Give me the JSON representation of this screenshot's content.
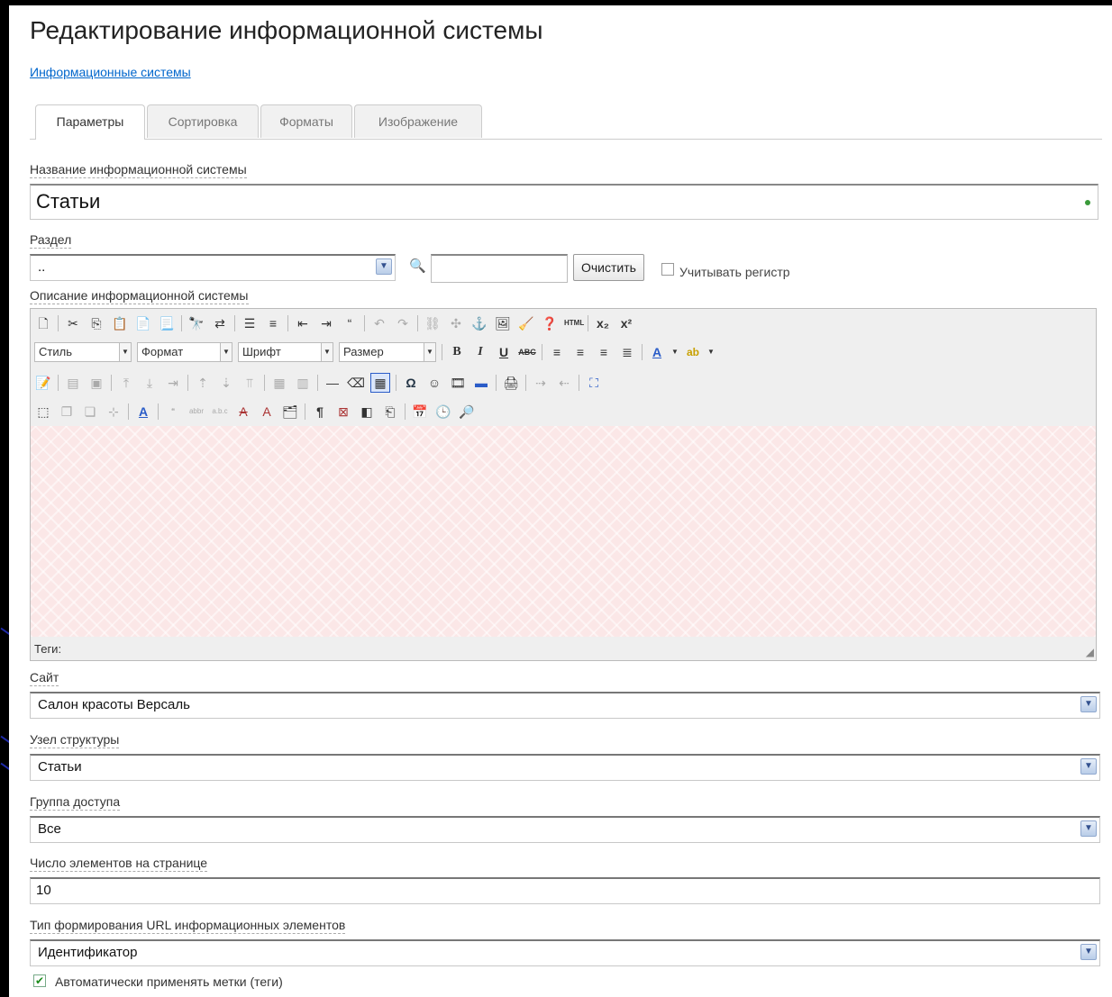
{
  "page": {
    "title": "Редактирование информационной системы",
    "breadcrumb": "Информационные системы"
  },
  "tabs": [
    {
      "label": "Параметры"
    },
    {
      "label": "Сортировка"
    },
    {
      "label": "Форматы"
    },
    {
      "label": "Изображение"
    }
  ],
  "form": {
    "name_label": "Название информационной системы",
    "name_value": "Статьи",
    "section_label": "Раздел",
    "section_value": "..",
    "clear_button": "Очистить",
    "case_sensitive_label": "Учитывать регистр",
    "description_label": "Описание информационной системы",
    "site_label": "Сайт",
    "site_value": "Салон красоты Версаль",
    "structure_label": "Узел структуры",
    "structure_value": "Статьи",
    "access_label": "Группа доступа",
    "access_value": "Все",
    "per_page_label": "Число элементов на странице",
    "per_page_value": "10",
    "url_type_label": "Тип формирования URL информационных элементов",
    "url_type_value": "Идентификатор",
    "auto_tags_label": "Автоматически применять метки (теги)"
  },
  "editor": {
    "style_combo": "Стиль",
    "format_combo": "Формат",
    "font_combo": "Шрифт",
    "size_combo": "Размер",
    "status_label": "Теги:"
  }
}
